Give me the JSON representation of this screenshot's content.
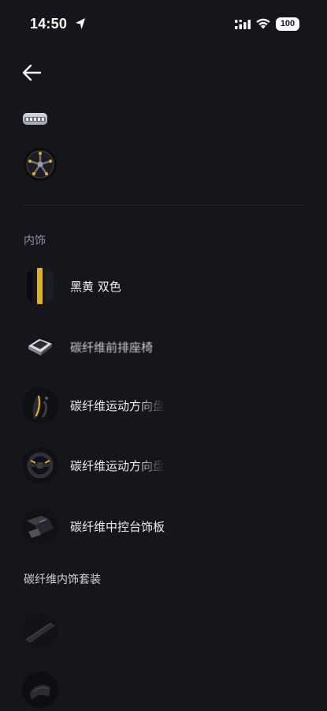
{
  "status_bar": {
    "time": "14:50",
    "battery": "100",
    "icons": [
      "location-arrow-icon",
      "cellular-signal-icon",
      "wifi-icon",
      "battery-icon"
    ]
  },
  "header": {
    "back_icon": "arrow-left-icon"
  },
  "exterior": {
    "wheel_icon": "wheel-icon"
  },
  "interior": {
    "section_title": "内饰",
    "options": [
      {
        "label": "黑黄 双色",
        "icon": "black-yellow-swatch-icon"
      },
      {
        "label": "碳纤维前排座椅",
        "icon": "carbon-seat-icon"
      },
      {
        "label": "碳纤维运动方向盘",
        "icon": "steering-wheel-icon"
      },
      {
        "label": "碳纤维中控台饰板",
        "icon": "center-console-trim-icon"
      }
    ]
  },
  "carbon_interior_pack": {
    "section_title": "碳纤维内饰套装",
    "items": [
      {
        "icon": "carbon-trim-strip-icon"
      },
      {
        "icon": "carbon-panel-icon"
      }
    ]
  },
  "colors": {
    "background": "#15161b",
    "accent_yellow": "#e0b21a",
    "text_primary": "#eceef2",
    "text_secondary": "#8c8f98"
  }
}
